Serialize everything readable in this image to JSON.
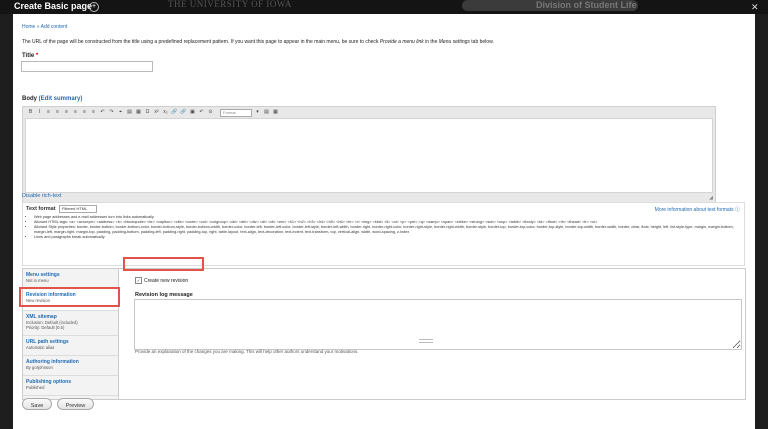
{
  "topbar": {
    "title": "Create Basic page",
    "add_icon": "plus-circle-icon",
    "university": "THE UNIVERSITY OF IOWA",
    "division": "Division of Student Life",
    "close_icon": "close-icon"
  },
  "breadcrumb": "Home » Add content",
  "intro": {
    "text_a": "The URL of the page will be constructed from the title using a predefined replacement pattern. If you want this page to appear in the main menu, be sure to check ",
    "em_a": "Provide a menu link",
    "text_b": " in the ",
    "em_b": "Menu settings",
    "text_c": " tab below."
  },
  "title_field": {
    "label": "Title",
    "required": "*",
    "value": ""
  },
  "body_field": {
    "label": "Body",
    "edit_summary": "(Edit summary)"
  },
  "editor": {
    "toolbar": [
      "B",
      "I",
      "≡",
      "≡",
      "≡",
      "≡",
      "≡",
      "≡",
      "↶",
      "↷",
      "⌖",
      "▤",
      "▦",
      "Ω",
      "x²",
      "x₂",
      "🔗",
      "🔗",
      "▣",
      "↶",
      "⊙"
    ],
    "format_placeholder": "Format",
    "extra": [
      "▤",
      "▦"
    ],
    "resize_icon": "◢"
  },
  "disable_rich_text": "Disable rich-text",
  "text_format": {
    "label": "Text format",
    "selected": "Filtered HTML",
    "more_info": "More information about text formats",
    "help_icon": "question-circle-icon",
    "tips": [
      "Web page addresses and e-mail addresses turn into links automatically.",
      "Allowed HTML tags: <a> <acronym> <address> <b> <blockquote> <br> <caption> <cite> <code> <col> <colgroup> <dd> <del> <div> <dl> <dt> <em> <h1> <h2> <h3> <h4> <h5> <h6> <hr> <i> <img> <kbd> <li> <ol> <p> <pre> <q> <samp> <span> <strike> <strong> <sub> <sup> <table> <tbody> <td> <tfoot> <th> <thead> <tr> <ul>",
      "Allowed Style properties: border, border-bottom, border-bottom-color, border-bottom-style, border-bottom-width, border-color, border-left, border-left-color, border-left-style, border-left-width, border-right, border-right-color, border-right-style, border-right-width, border-style, border-top, border-top-color, border-top-style, border-top-width, border-width, border, clear, float, height, left, list-style-type, margin, margin-bottom, margin-left, margin-right, margin-top, padding, padding-bottom, padding-left, padding-right, padding-top, right, table-layout, text-align, text-decoration, text-indent, text-transform, top, vertical-align, width, word-spacing, z-index",
      "Lines and paragraphs break automatically."
    ]
  },
  "vertical_tabs": [
    {
      "title": "Menu settings",
      "summary": [
        "Not in menu"
      ]
    },
    {
      "title": "Revision information",
      "summary": [
        "New revision"
      ]
    },
    {
      "title": "XML sitemap",
      "summary": [
        "Inclusion: Default (included)",
        "Priority: Default (0.5)"
      ]
    },
    {
      "title": "URL path settings",
      "summary": [
        "Automatic alias"
      ]
    },
    {
      "title": "Authoring information",
      "summary": [
        "By gorjohnson"
      ]
    },
    {
      "title": "Publishing options",
      "summary": [
        "Published"
      ]
    }
  ],
  "revision": {
    "checkbox_label": "Create new revision",
    "checked": "✓",
    "log_label": "Revision log message",
    "log_value": "",
    "description": "Provide an explanation of the changes you are making. This will help other authors understand your motivations."
  },
  "actions": {
    "save": "Save",
    "preview": "Preview"
  },
  "colors": {
    "link": "#1f6bb5",
    "highlight": "#e2534a",
    "chrome": "#141414"
  }
}
